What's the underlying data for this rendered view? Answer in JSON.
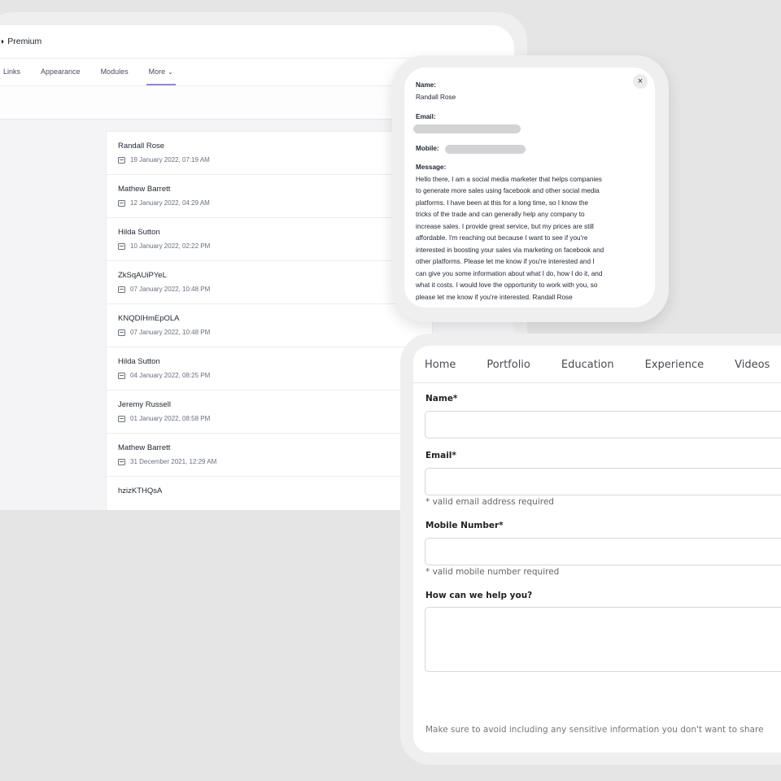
{
  "dashboard": {
    "title": "Premium",
    "nav": [
      {
        "label": "Links"
      },
      {
        "label": "Appearance"
      },
      {
        "label": "Modules"
      },
      {
        "label": "More"
      }
    ],
    "entries": [
      {
        "name": "Randall Rose",
        "date": "19 January 2022, 07:19 AM"
      },
      {
        "name": "Mathew Barrett",
        "date": "12 January 2022, 04:29 AM"
      },
      {
        "name": "Hilda Sutton",
        "date": "10 January 2022, 02:22 PM"
      },
      {
        "name": "ZkSqAUiPYeL",
        "date": "07 January 2022, 10:48 PM"
      },
      {
        "name": "KNQDIHmEpOLA",
        "date": "07 January 2022, 10:48 PM"
      },
      {
        "name": "Hilda Sutton",
        "date": "04 January 2022, 08:25 PM"
      },
      {
        "name": "Jeremy Russell",
        "date": "01 January 2022, 08:58 PM"
      },
      {
        "name": "Mathew Barrett",
        "date": "31 December 2021, 12:29 AM"
      },
      {
        "name": "hzizKTHQsA",
        "date": ""
      }
    ]
  },
  "message_popup": {
    "close": "×",
    "name_label": "Name:",
    "name_value": "Randall Rose",
    "email_label": "Email:",
    "mobile_label": "Mobile:",
    "message_label": "Message:",
    "message_lines": [
      "Hello there, I am a social media marketer that helps companies",
      "to generate more sales using facebook and other social media",
      "platforms. I have been at this for a long time, so I know the",
      "tricks of the trade and can generally help any company to",
      "increase sales. I provide great service, but my prices are still",
      "affordable. I'm reaching out because I want to see if you're",
      "interested in boosting your sales via marketing on facebook and",
      "other platforms. Please let me know if you're interested and I",
      "can give you some information about what I do, how I do it, and",
      "what it costs. I would love the opportunity to work with you, so",
      "please let me know if you're interested. Randall Rose"
    ]
  },
  "contact_form": {
    "tabs": [
      "Home",
      "Portfolio",
      "Education",
      "Experience",
      "Videos"
    ],
    "name_label": "Name*",
    "email_label": "Email*",
    "email_hint": "* valid email address required",
    "mobile_label": "Mobile Number*",
    "mobile_hint": "* valid mobile number required",
    "message_label": "How can we help you?",
    "note": "Make sure to avoid including any sensitive information you don't want to share"
  }
}
